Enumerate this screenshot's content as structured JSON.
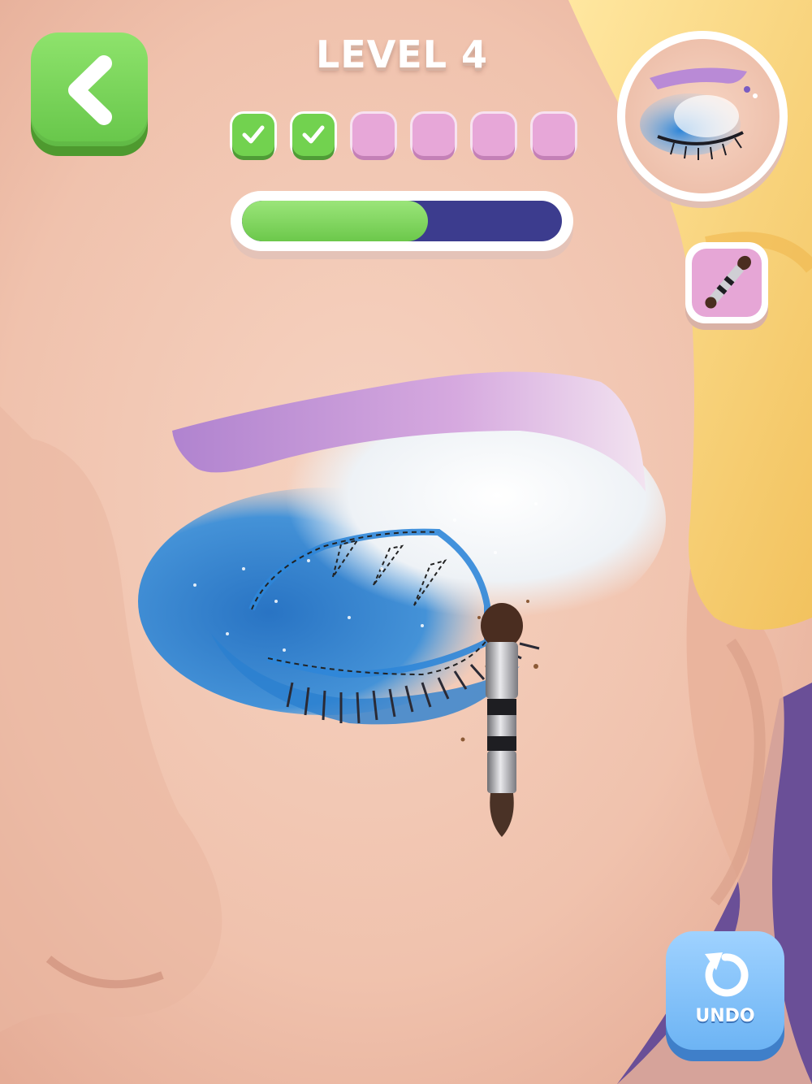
{
  "game": {
    "title": "LEVEL 4",
    "progress_fraction": 0.58,
    "steps": [
      {
        "state": "done"
      },
      {
        "state": "done"
      },
      {
        "state": "todo"
      },
      {
        "state": "todo"
      },
      {
        "state": "todo"
      },
      {
        "state": "todo"
      }
    ]
  },
  "buttons": {
    "back_icon": "chevron-left-icon",
    "tool_icon": "sponge-brush-icon",
    "undo_icon": "undo-arrow-icon",
    "undo_label": "UNDO"
  },
  "colors": {
    "accent_green": "#72d24f",
    "step_pending": "#e7a7d8",
    "progress_track": "#3c3c8e",
    "undo_blue": "#6db4f4",
    "eyeshadow_blue": "#2f86d8",
    "brow_lilac": "#c79ad8"
  }
}
